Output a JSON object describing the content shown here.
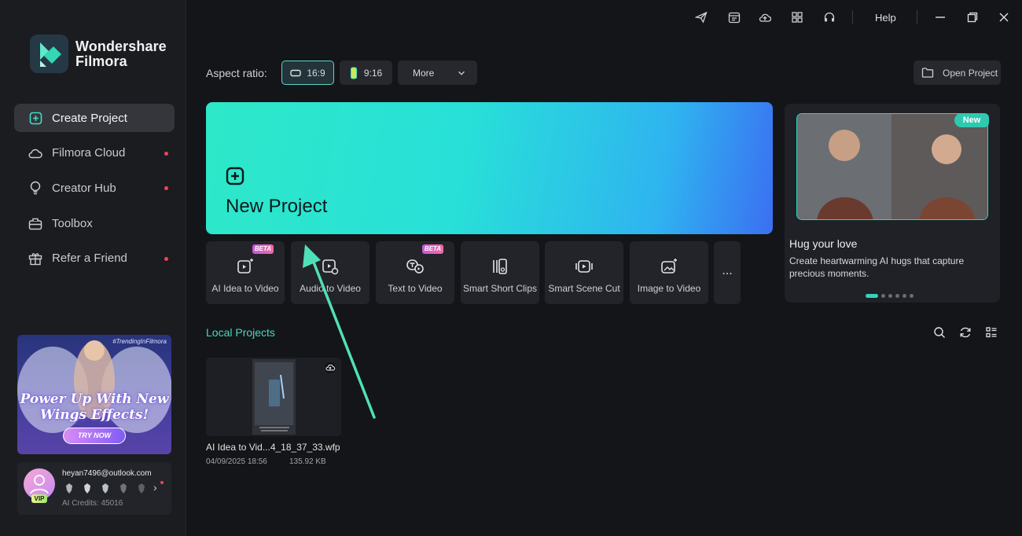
{
  "app": {
    "brand_line1": "Wondershare",
    "brand_line2": "Filmora"
  },
  "titlebar": {
    "help_label": "Help",
    "icons": [
      "send-icon",
      "calendar-icon",
      "cloud-upload-icon",
      "grid-icon",
      "headset-icon",
      "minimize-icon",
      "restore-icon",
      "close-icon"
    ]
  },
  "sidebar": {
    "items": [
      {
        "label": "Create Project",
        "icon": "plus-square-icon",
        "active": true,
        "dot": false
      },
      {
        "label": "Filmora Cloud",
        "icon": "cloud-icon",
        "active": false,
        "dot": true
      },
      {
        "label": "Creator Hub",
        "icon": "bulb-icon",
        "active": false,
        "dot": true
      },
      {
        "label": "Toolbox",
        "icon": "toolbox-icon",
        "active": false,
        "dot": false
      },
      {
        "label": "Refer a Friend",
        "icon": "gift-icon",
        "active": false,
        "dot": true
      }
    ],
    "promo": {
      "tag": "#TrendingInFilmora",
      "title": "Power Up With New Wings Effects!",
      "cta": "TRY NOW"
    },
    "account": {
      "email": "heyan7496@outlook.com",
      "vip": "VIP",
      "credits": "AI Credits: 45016"
    }
  },
  "toolbar": {
    "aspect_label": "Aspect ratio:",
    "ratio_169": "16:9",
    "ratio_916": "9:16",
    "more_label": "More",
    "open_project": "Open Project"
  },
  "new_project": {
    "label": "New Project"
  },
  "tools": [
    {
      "label": "AI Idea to Video",
      "beta": "BETA"
    },
    {
      "label": "Audio to Video",
      "beta": ""
    },
    {
      "label": "Text to Video",
      "beta": "BETA"
    },
    {
      "label": "Smart Short Clips",
      "beta": ""
    },
    {
      "label": "Smart Scene Cut",
      "beta": ""
    },
    {
      "label": "Image to Video",
      "beta": ""
    }
  ],
  "tools_more": "...",
  "feature_card": {
    "badge": "New",
    "title": "Hug your love",
    "description": "Create heartwarming AI hugs that capture precious moments.",
    "slides": 6,
    "active_slide": 1
  },
  "local_projects": {
    "title": "Local Projects",
    "items": [
      {
        "name": "AI Idea to Vid...4_18_37_33.wfp",
        "date": "04/09/2025 18:56",
        "size": "135.92 KB"
      }
    ]
  },
  "colors": {
    "accent": "#48d8bd",
    "notification": "#f0445a",
    "background": "#141518"
  }
}
